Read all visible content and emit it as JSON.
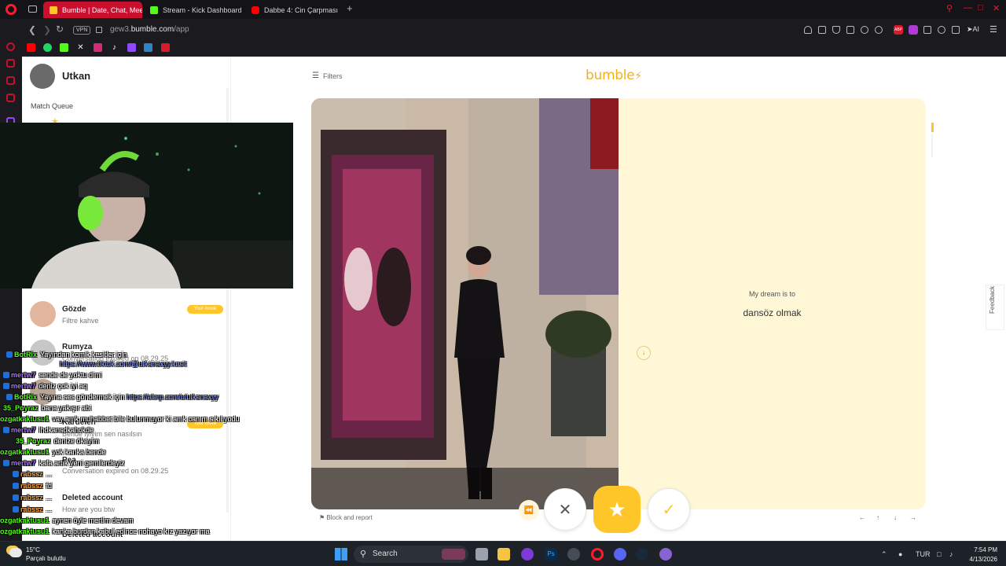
{
  "browser": {
    "tabs": [
      {
        "label": "Bumble | Date, Chat, Meet",
        "active": true,
        "favicon_color": "#ffc629"
      },
      {
        "label": "Stream - Kick Dashboard",
        "active": false,
        "favicon_color": "#53fc18"
      },
      {
        "label": "Dabbe 4: Cin Çarpması | 4",
        "active": false,
        "favicon_color": "#ff0000"
      }
    ],
    "new_tab": "+",
    "vpn_label": "VPN",
    "url_host": "gew3.",
    "url_domain": "bumble.com",
    "url_path": "/app",
    "ai_label": "AI",
    "abp_label": "ABP"
  },
  "bumble": {
    "user_name": "Utkan",
    "match_queue_label": "Match Queue",
    "filters_label": "Filters",
    "logo_text": "bumble",
    "conversations": [
      {
        "name": "Gözde",
        "subtitle": "Filtre kahve",
        "badge": "Your move"
      },
      {
        "name": "Rumyza",
        "subtitle": "Conversation expired on 08.29.25"
      },
      {
        "name": "Kardelen",
        "subtitle": "Bende iyiyim sen nasılsın",
        "badge": "Your move"
      },
      {
        "name": "Pea",
        "subtitle": "Conversation expired on 08.29.25"
      },
      {
        "name": "Deleted account",
        "subtitle": "How are you btw"
      },
      {
        "name": "Deleted account",
        "subtitle": ""
      }
    ],
    "profile_card": {
      "prompt_label": "My dream is to",
      "prompt_answer": "dansöz olmak"
    },
    "block_report_label": "Block and report",
    "keyboard_hints": [
      "←",
      "↑",
      "↓",
      "→"
    ],
    "feedback_label": "Feedback"
  },
  "chat": [
    {
      "user": "BotRix",
      "color": "#53fc18",
      "text": "Yayından komik kesitler için",
      "link": ""
    },
    {
      "user": "",
      "color": "#53fc18",
      "text": "",
      "link": "https://www.tiktok.com/@utkanaxyy.kesit"
    },
    {
      "user": "mertw7",
      "color": "#a970ff",
      "text": "sende de yoktu dimi",
      "link": ""
    },
    {
      "user": "mertw7",
      "color": "#a970ff",
      "text": "deniz çok iyi aq",
      "link": ""
    },
    {
      "user": "BotRix",
      "color": "#53fc18",
      "text": "Yayına ses göndermek için",
      "link": "https://alerp.com/u/utkanaxyy"
    },
    {
      "user": "35_Poyraz",
      "color": "#53fc18",
      "text": "bana yakışır abi",
      "link": ""
    },
    {
      "user": "ozgatkaktusu1",
      "color": "#53fc18",
      "text": "vay amk muhabbet bile bulunmuyor ki amk canım sıkılıyodu",
      "link": ""
    },
    {
      "user": "mertw7",
      "color": "#a970ff",
      "text": "lhdkansdkahckde",
      "link": ""
    },
    {
      "user": "35_Poyraz",
      "color": "#53fc18",
      "text": "denize ökeyim",
      "link": ""
    },
    {
      "user": "ozgatkaktusu1",
      "color": "#53fc18",
      "text": "yok kanka bende",
      "link": ""
    },
    {
      "user": "mertw7",
      "color": "#a970ff",
      "text": "kafa artık yeni gemilerdeyiz",
      "link": ""
    },
    {
      "user": "rabssz",
      "color": "#ff9d2e",
      "text": "...",
      "link": ""
    },
    {
      "user": "rabssz",
      "color": "#ff9d2e",
      "text": "fd",
      "link": ""
    },
    {
      "user": "rabssz",
      "color": "#ff9d2e",
      "text": "...",
      "link": ""
    },
    {
      "user": "rabssz",
      "color": "#ff9d2e",
      "text": "...",
      "link": ""
    },
    {
      "user": "ozgatkaktusu1",
      "color": "#53fc18",
      "text": "aynen öyle mertim devam",
      "link": ""
    },
    {
      "user": "ozgatkaktusu1",
      "color": "#53fc18",
      "text": "kanka burdan kabul edince nohayo kız yazıyor ma",
      "link": ""
    }
  ],
  "taskbar": {
    "temperature": "15°C",
    "weather_text": "Parçalı bulutlu",
    "search_label": "Search",
    "language": "TUR",
    "time": "7:54 PM",
    "date": "4/13/2026"
  }
}
